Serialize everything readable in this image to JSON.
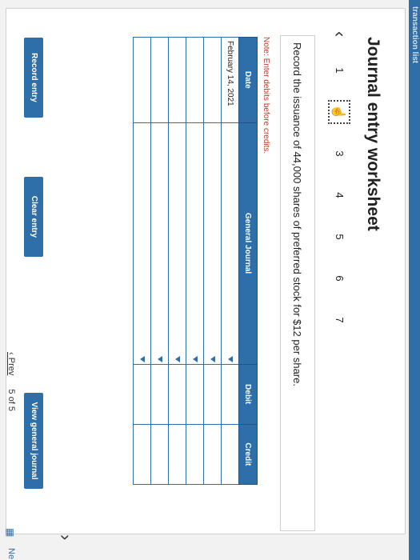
{
  "header": {
    "truncated_label": "transaction list"
  },
  "worksheet": {
    "title": "Journal entry worksheet",
    "prev_glyph": "‹",
    "next_glyph": "›",
    "steps": [
      "1",
      "2",
      "3",
      "4",
      "5",
      "6",
      "7"
    ],
    "active_step": 2,
    "prompt": "Record the issuance of 44,000 shares of preferred stock for $12 per share.",
    "note": "Note: Enter debits before credits."
  },
  "table": {
    "headers": {
      "date": "Date",
      "journal": "General Journal",
      "debit": "Debit",
      "credit": "Credit"
    },
    "rows": [
      {
        "date": "February 14, 2021",
        "account": "",
        "debit": "",
        "credit": ""
      },
      {
        "date": "",
        "account": "",
        "debit": "",
        "credit": ""
      },
      {
        "date": "",
        "account": "",
        "debit": "",
        "credit": ""
      },
      {
        "date": "",
        "account": "",
        "debit": "",
        "credit": ""
      },
      {
        "date": "",
        "account": "",
        "debit": "",
        "credit": ""
      },
      {
        "date": "",
        "account": "",
        "debit": "",
        "credit": ""
      }
    ]
  },
  "buttons": {
    "record": "Record entry",
    "clear": "Clear entry",
    "view": "View general journal"
  },
  "pager": {
    "prev": "Prev",
    "current": "5",
    "of_label": "of 5",
    "next_cut": "Ne"
  },
  "colors": {
    "brand": "#2f6fa9",
    "note": "#c0392b"
  }
}
